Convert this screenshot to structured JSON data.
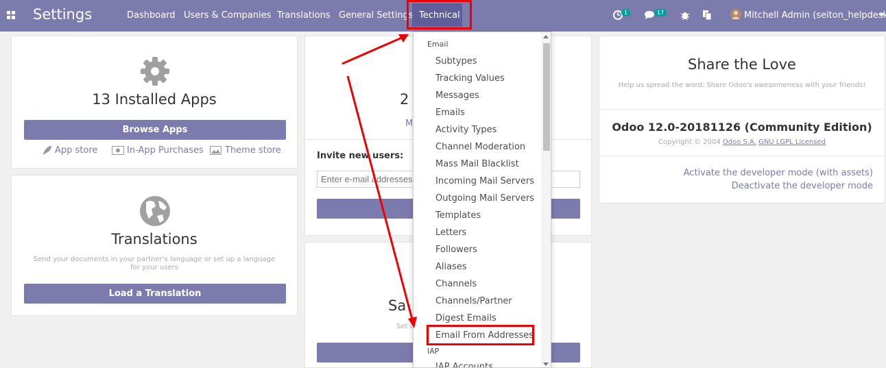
{
  "navbar": {
    "app_title": "Settings",
    "menu": [
      "Dashboard",
      "Users & Companies",
      "Translations",
      "General Settings",
      "Technical"
    ],
    "activity_badge": "1",
    "messages_badge": "17",
    "user": "Mitchell Admin (seiton_helpdesk)"
  },
  "apps_card": {
    "title": "13 Installed Apps",
    "button": "Browse Apps",
    "links": [
      "App store",
      "In-App Purchases",
      "Theme store"
    ]
  },
  "translations_card": {
    "title": "Translations",
    "description": "Send your documents in your partner's language or set up a language for your users",
    "button": "Load a Translation"
  },
  "users_card": {
    "count": "2",
    "link_partial": "M",
    "invite_label": "Invite new users:",
    "invite_placeholder": "Enter e-mail addresses"
  },
  "sample_card": {
    "title_partial": "Sa",
    "text_partial": "Set u"
  },
  "share_card": {
    "title": "Share the Love",
    "subtitle": "Help us spread the word: Share Odoo's awesomeness with your friends!",
    "version": "Odoo 12.0-20181126 (Community Edition)",
    "copyright_prefix": "Copyright © 2004",
    "company_link": "Odoo S.A.",
    "license_link": "GNU LGPL Licensed",
    "dev_mode_assets": "Activate the developer mode (with assets)",
    "dev_mode_off": "Deactivate the developer mode"
  },
  "dropdown": {
    "section_email": "Email",
    "items": [
      "Subtypes",
      "Tracking Values",
      "Messages",
      "Emails",
      "Activity Types",
      "Channel Moderation",
      "Mass Mail Blacklist",
      "Incoming Mail Servers",
      "Outgoing Mail Servers",
      "Templates",
      "Letters",
      "Followers",
      "Aliases",
      "Channels",
      "Channels/Partner",
      "Digest Emails",
      "Email From Addresses"
    ],
    "section_iap": "IAP",
    "iap_item": "IAP Accounts"
  },
  "colors": {
    "brand": "#7c7bad",
    "highlight": "#e00000",
    "badge": "#00a09d"
  }
}
